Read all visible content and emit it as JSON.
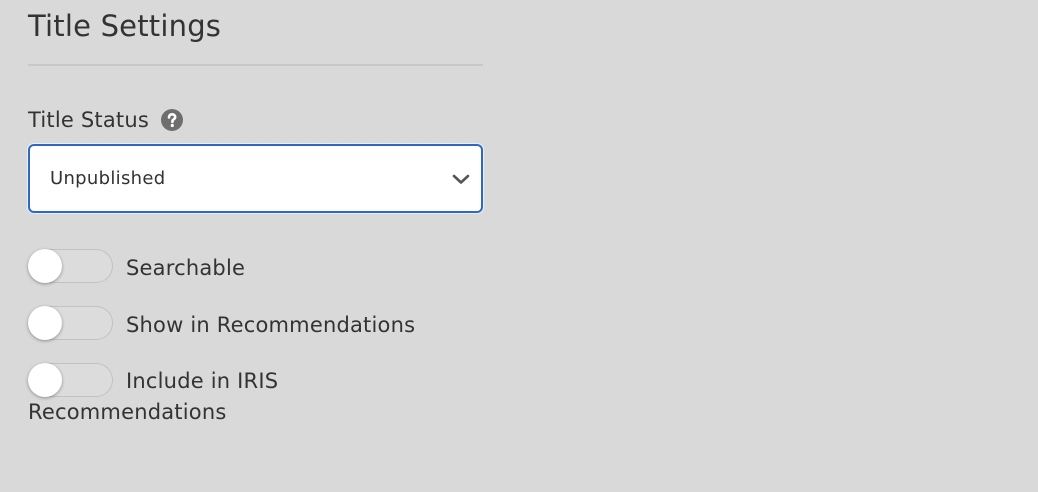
{
  "settings": {
    "title": "Title Settings",
    "status_label": "Title Status",
    "status_value": "Unpublished",
    "help_icon": "question-circle-icon",
    "chevron_icon": "chevron-down-icon",
    "accent_color": "#2f68c4",
    "toggles": [
      {
        "label": "Searchable",
        "on": false
      },
      {
        "label": "Show in Recommendations",
        "on": false
      },
      {
        "label": "Include in IRIS Recommendations",
        "on": false
      }
    ]
  }
}
